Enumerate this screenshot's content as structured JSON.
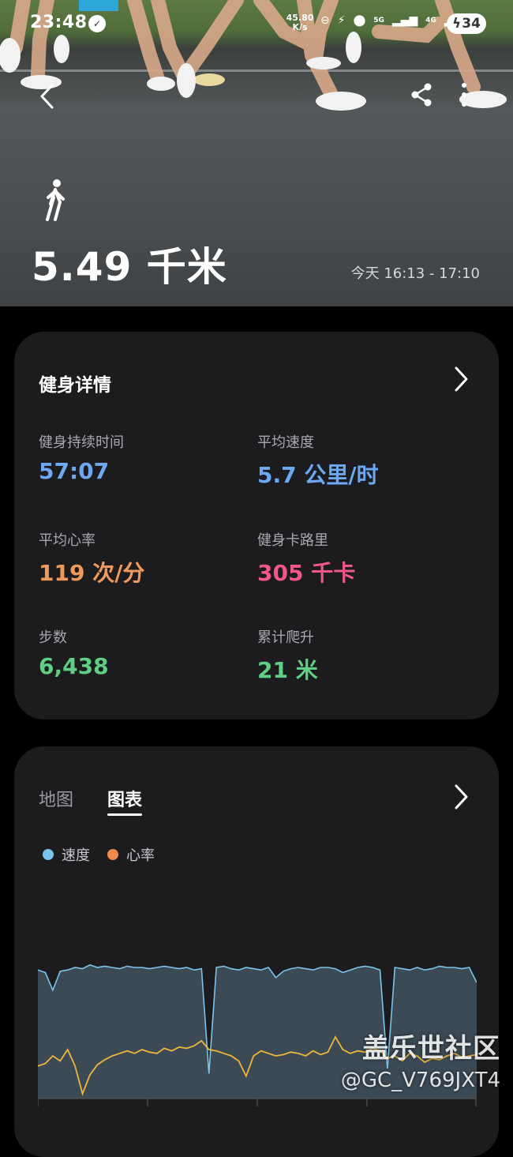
{
  "status_bar": {
    "time": "23:48",
    "network_speed_value": "45.80",
    "network_speed_unit": "K/s",
    "signal_5g": "5G",
    "signal_4g": "4G",
    "battery": "34"
  },
  "hero": {
    "distance": "5.49 千米",
    "date_range": "今天 16:13 - 17:10"
  },
  "details": {
    "title": "健身详情",
    "stats": [
      {
        "label": "健身持续时间",
        "value": "57:07"
      },
      {
        "label": "平均速度",
        "value": "5.7 公里/时"
      },
      {
        "label": "平均心率",
        "value": "119 次/分"
      },
      {
        "label": "健身卡路里",
        "value": "305 千卡"
      },
      {
        "label": "步数",
        "value": "6,438"
      },
      {
        "label": "累计爬升",
        "value": "21 米"
      }
    ]
  },
  "chart_card": {
    "tabs": [
      {
        "label": "地图",
        "active": false
      },
      {
        "label": "图表",
        "active": true
      }
    ],
    "legend": [
      {
        "label": "速度",
        "color": "#7cc4ec"
      },
      {
        "label": "心率",
        "color": "#f08a4b"
      }
    ]
  },
  "chart_data": {
    "type": "area",
    "series": [
      {
        "name": "速度",
        "color": "#7cc4ec",
        "values": [
          0.88,
          0.86,
          0.72,
          0.87,
          0.88,
          0.9,
          0.89,
          0.92,
          0.9,
          0.91,
          0.9,
          0.89,
          0.91,
          0.9,
          0.9,
          0.89,
          0.9,
          0.91,
          0.9,
          0.89,
          0.9,
          0.88,
          0.89,
          0.06,
          0.9,
          0.91,
          0.89,
          0.88,
          0.9,
          0.89,
          0.88,
          0.9,
          0.82,
          0.87,
          0.89,
          0.9,
          0.89,
          0.88,
          0.9,
          0.9,
          0.89,
          0.86,
          0.88,
          0.9,
          0.91,
          0.9,
          0.88,
          0.1,
          0.9,
          0.89,
          0.88,
          0.9,
          0.88,
          0.89,
          0.91,
          0.9,
          0.9,
          0.89,
          0.9,
          0.78
        ]
      },
      {
        "name": "心率",
        "color": "#f0b53c",
        "values": [
          0.12,
          0.14,
          0.2,
          0.16,
          0.25,
          0.12,
          -0.1,
          0.05,
          0.13,
          0.17,
          0.2,
          0.22,
          0.24,
          0.22,
          0.25,
          0.23,
          0.22,
          0.26,
          0.24,
          0.27,
          0.26,
          0.28,
          0.32,
          0.25,
          0.24,
          0.22,
          0.2,
          0.16,
          0.04,
          0.2,
          0.24,
          0.22,
          0.2,
          0.21,
          0.23,
          0.22,
          0.2,
          0.24,
          0.21,
          0.23,
          0.35,
          0.25,
          0.22,
          0.24,
          0.23,
          0.26,
          0.24,
          0.18,
          0.2,
          0.16,
          0.22,
          0.2,
          0.15,
          0.18,
          0.17,
          0.2,
          0.22,
          0.19,
          0.2,
          0.21
        ]
      }
    ]
  },
  "watermark": {
    "line1": "盖乐世社区",
    "line2": "@GC_V769JXT4"
  }
}
